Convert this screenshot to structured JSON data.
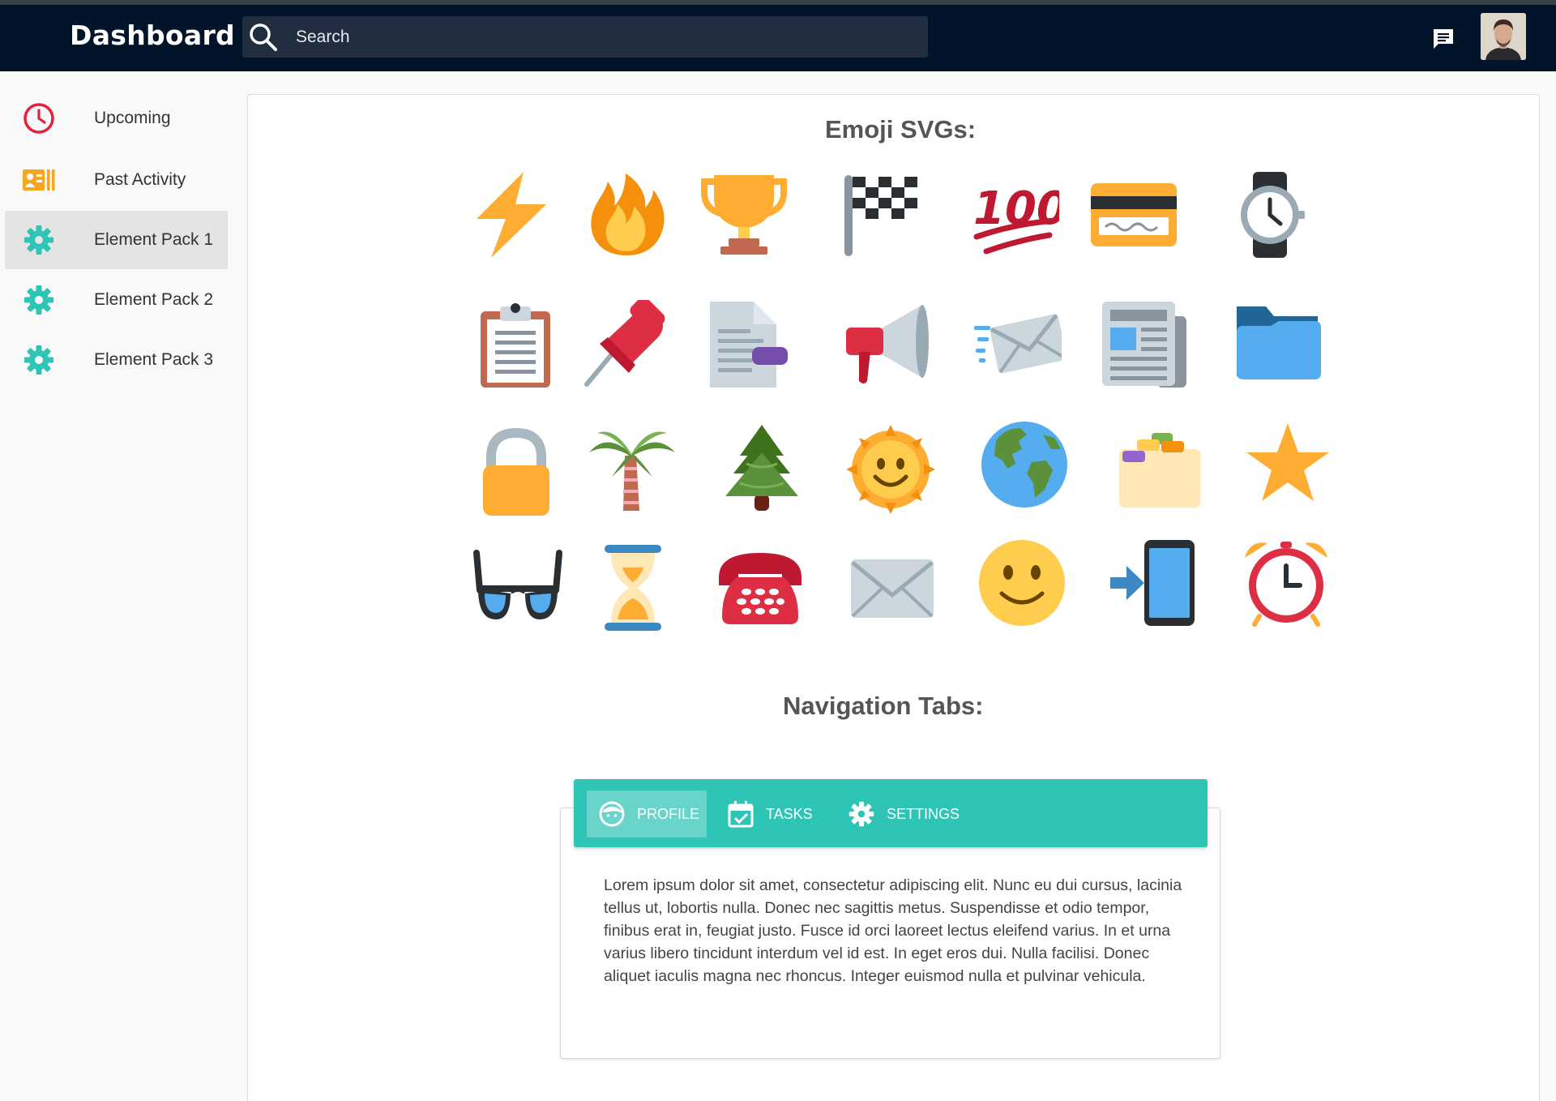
{
  "header": {
    "brand": "Dashboard",
    "search_placeholder": "Search"
  },
  "sidebar": {
    "items": [
      {
        "label": "Upcoming",
        "icon": "clock-icon"
      },
      {
        "label": "Past Activity",
        "icon": "activity-icon"
      },
      {
        "label": "Element Pack 1",
        "icon": "gear-icon",
        "active": true
      },
      {
        "label": "Element Pack 2",
        "icon": "gear-icon"
      },
      {
        "label": "Element Pack 3",
        "icon": "gear-icon"
      }
    ]
  },
  "main": {
    "emoji_title": "Emoji SVGs:",
    "emojis": [
      [
        "lightning-icon",
        "fire-icon",
        "trophy-icon",
        "checkered-flag-icon",
        "hundred-points-icon",
        "credit-card-icon",
        "watch-icon"
      ],
      [
        "clipboard-icon",
        "pushpin-icon",
        "document-icon",
        "megaphone-icon",
        "incoming-envelope-icon",
        "newspaper-icon",
        "folder-icon"
      ],
      [
        "lock-icon",
        "palm-tree-icon",
        "evergreen-tree-icon",
        "sun-icon",
        "globe-icon",
        "card-index-icon",
        "star-icon"
      ],
      [
        "glasses-icon",
        "hourglass-icon",
        "telephone-icon",
        "envelope-icon",
        "smiley-icon",
        "phone-arrow-icon",
        "alarm-clock-icon"
      ]
    ],
    "tabs_title": "Navigation Tabs:",
    "tabs": [
      {
        "label": "Profile",
        "icon": "profile-face-icon",
        "active": true
      },
      {
        "label": "Tasks",
        "icon": "calendar-check-icon"
      },
      {
        "label": "Settings",
        "icon": "gear-icon"
      }
    ],
    "tab_content": "Lorem ipsum dolor sit amet, consectetur adipiscing elit. Nunc eu dui cursus, lacinia tellus ut, lobortis nulla. Donec nec sagittis metus. Suspendisse et odio tempor, finibus erat in, feugiat justo. Fusce id orci laoreet lectus eleifend varius. In et urna varius libero tincidunt interdum vel id est. In eget eros dui. Nulla facilisi. Donec aliquet iaculis magna nec rhoncus. Integer euismod nulla et pulvinar vehicula."
  },
  "colors": {
    "topbar": "#02142a",
    "search_bg": "#212e40",
    "accent_teal": "#2ec4b6",
    "clock_red": "#e0223b",
    "activity_orange": "#f5a623"
  }
}
